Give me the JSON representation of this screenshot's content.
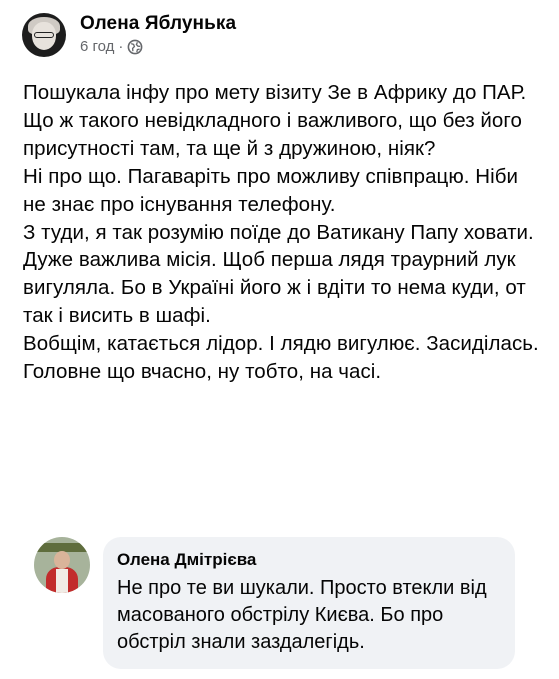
{
  "post": {
    "author": "Олена Яблунька",
    "time": "6 год",
    "separator": "·",
    "privacy_icon": "globe-icon",
    "paragraphs": [
      "Пошукала інфу про мету візиту Зе в Африку до ПАР. Що ж такого невідкладного і важливого, що без його присутності там, та ще й з дружиною, ніяк?",
      "Ні про що. Пагаваріть про можливу співпрацю. Ніби не знає про існування телефону.",
      "З туди, я так розумію поїде до Ватикану Папу ховати. Дуже важлива місія. Щоб перша лядя траурний лук вигуляла. Бо в Україні його ж і вдіти то нема куди, от так і висить в шафі.",
      "Вобщім, катається лідор. І лядю вигулює. Засиділась.",
      "Головне що вчасно, ну тобто, на часі."
    ]
  },
  "comment": {
    "author": "Олена Дмітрієва",
    "text": "Не про те ви шукали. Просто втекли від масованого обстрілу Києва. Бо про обстріл знали заздалегідь."
  }
}
